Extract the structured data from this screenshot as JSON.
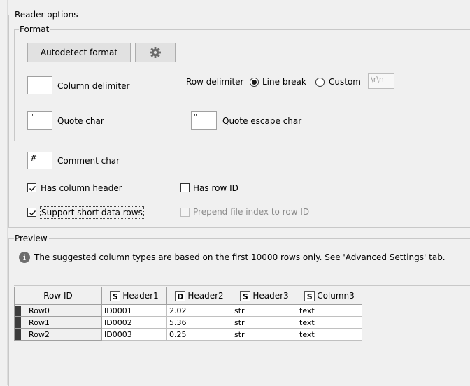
{
  "reader_options": {
    "title": "Reader options",
    "format": {
      "title": "Format",
      "autodetect_label": "Autodetect format",
      "settings_icon": "gear-icon",
      "column_delimiter": {
        "value": "",
        "label": "Column delimiter"
      },
      "row_delimiter": {
        "label": "Row delimiter",
        "line_break_label": "Line break",
        "custom_label": "Custom",
        "custom_value": "\\r\\n",
        "selected": "Line break"
      },
      "quote_char": {
        "value": "\"",
        "label": "Quote char"
      },
      "quote_escape_char": {
        "value": "\"",
        "label": "Quote escape char"
      }
    },
    "comment_char": {
      "value": "#",
      "label": "Comment char"
    },
    "has_column_header": {
      "label": "Has column header",
      "checked": true
    },
    "has_row_id": {
      "label": "Has row ID",
      "checked": false
    },
    "support_short_data_rows": {
      "label": "Support short data rows",
      "checked": true
    },
    "prepend_file_index": {
      "label": "Prepend file index to row ID",
      "checked": false,
      "disabled": true
    }
  },
  "preview": {
    "title": "Preview",
    "info_icon": "info-icon",
    "info_text": "The suggested column types are based on the first 10000 rows only. See 'Advanced Settings' tab.",
    "columns": [
      {
        "type": "",
        "name": "Row ID"
      },
      {
        "type": "S",
        "name": "Header1"
      },
      {
        "type": "D",
        "name": "Header2"
      },
      {
        "type": "S",
        "name": "Header3"
      },
      {
        "type": "S",
        "name": "Column3"
      }
    ],
    "rows": [
      [
        "Row0",
        "ID0001",
        "2.02",
        "str",
        "text"
      ],
      [
        "Row1",
        "ID0002",
        "5.36",
        "str",
        "text"
      ],
      [
        "Row2",
        "ID0003",
        "0.25",
        "str",
        "text"
      ]
    ]
  }
}
